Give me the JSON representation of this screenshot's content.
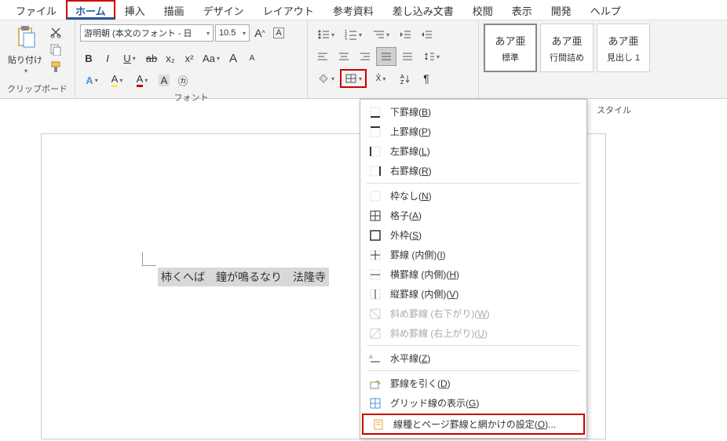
{
  "tabs": {
    "file": "ファイル",
    "home": "ホーム",
    "insert": "挿入",
    "draw": "描画",
    "design": "デザイン",
    "layout": "レイアウト",
    "references": "参考資料",
    "mailings": "差し込み文書",
    "review": "校閲",
    "view": "表示",
    "developer": "開発",
    "help": "ヘルプ"
  },
  "clipboard": {
    "paste": "貼り付け",
    "group_label": "クリップボード"
  },
  "font": {
    "name": "游明朝 (本文のフォント - 日",
    "size": "10.5",
    "group_label": "フォント",
    "bold": "B",
    "italic": "I",
    "underline": "U",
    "strike": "ab",
    "sub": "x₂",
    "sup": "x²",
    "aa": "Aa",
    "increase": "A",
    "decrease": "A",
    "clear": "A",
    "ruby": "A",
    "enclose": "A",
    "highlight": "A",
    "fontcolor": "A",
    "circled": "㋕"
  },
  "para": {
    "shading": "borders"
  },
  "styles": {
    "sample": "あア亜",
    "normal": "標準",
    "nospace": "行間詰め",
    "heading1": "見出し 1",
    "group_label": "スタイル"
  },
  "document": {
    "text": "柿くへば　鐘が鳴るなり　法隆寺"
  },
  "borders_menu": {
    "bottom": "下罫線(B)",
    "top": "上罫線(P)",
    "left": "左罫線(L)",
    "right": "右罫線(R)",
    "none": "枠なし(N)",
    "grid": "格子(A)",
    "outside": "外枠(S)",
    "inside": "罫線 (内側)(I)",
    "inside_h": "横罫線 (内側)(H)",
    "inside_v": "縦罫線 (内側)(V)",
    "diag_down": "斜め罫線 (右下がり)(W)",
    "diag_up": "斜め罫線 (右上がり)(U)",
    "hline": "水平線(Z)",
    "draw": "罫線を引く(D)",
    "gridlines": "グリッド線の表示(G)",
    "settings": "線種とページ罫線と網かけの設定(O)..."
  }
}
